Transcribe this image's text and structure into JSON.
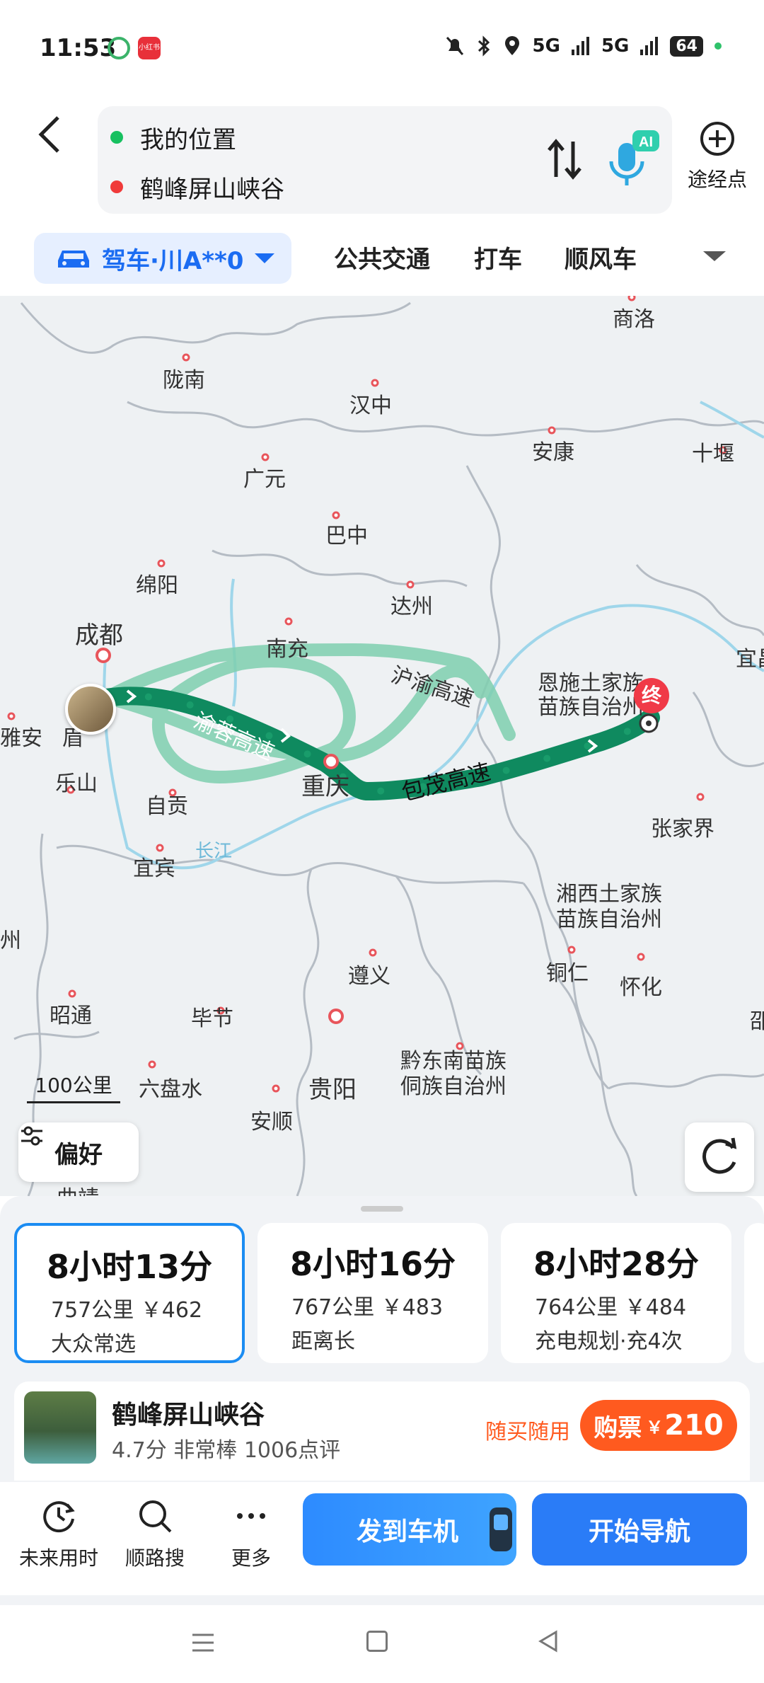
{
  "status_bar": {
    "time": "11:53",
    "app_icon_2_text": "小红书",
    "network_1": "5G",
    "network_2": "5G",
    "battery": "64"
  },
  "route": {
    "start": "我的位置",
    "destination": "鹤峰屏山峡谷",
    "waypoint_label": "途经点",
    "ai_badge": "AI"
  },
  "modes": {
    "drive": "驾车·川A**0",
    "transit": "公共交通",
    "taxi": "打车",
    "carpool": "顺风车"
  },
  "map": {
    "cities": [
      {
        "name": "商洛"
      },
      {
        "name": "陇南"
      },
      {
        "name": "汉中"
      },
      {
        "name": "安康"
      },
      {
        "name": "十堰"
      },
      {
        "name": "广元"
      },
      {
        "name": "巴中"
      },
      {
        "name": "绵阳"
      },
      {
        "name": "达州"
      },
      {
        "name": "成都"
      },
      {
        "name": "南充"
      },
      {
        "name": "恩施土家族"
      },
      {
        "name": "苗族自治州"
      },
      {
        "name": "宜昌"
      },
      {
        "name": "雅安"
      },
      {
        "name": "眉"
      },
      {
        "name": "乐山"
      },
      {
        "name": "自贡"
      },
      {
        "name": "重庆"
      },
      {
        "name": "张家界"
      },
      {
        "name": "宜宾"
      },
      {
        "name": "长江"
      },
      {
        "name": "湘西土家族"
      },
      {
        "name": "苗族自治州"
      },
      {
        "name": "州"
      },
      {
        "name": "遵义"
      },
      {
        "name": "铜仁"
      },
      {
        "name": "怀化"
      },
      {
        "name": "昭通"
      },
      {
        "name": "毕节"
      },
      {
        "name": "黔东南苗族"
      },
      {
        "name": "侗族自治州"
      },
      {
        "name": "六盘水"
      },
      {
        "name": "贵阳"
      },
      {
        "name": "安顺"
      },
      {
        "name": "曲靖"
      },
      {
        "name": "邵"
      }
    ],
    "highway_labels": [
      "沪渝高速",
      "渝蓉高速",
      "包茂高速"
    ],
    "end_marker": "终",
    "scale": "100公里",
    "preference": "偏好"
  },
  "routes": [
    {
      "time": "8小时13分",
      "distance": "757公里",
      "cost": "￥462",
      "tag": "大众常选"
    },
    {
      "time": "8小时16分",
      "distance": "767公里",
      "cost": "￥483",
      "tag": "距离长"
    },
    {
      "time": "8小时28分",
      "distance": "764公里",
      "cost": "￥484",
      "tag": "充电规划·充4次"
    }
  ],
  "poi": {
    "name": "鹤峰屏山峡谷",
    "rating": "4.7分",
    "rating_text": "非常棒",
    "reviews": "1006点评",
    "tag": "随买随用",
    "buy_label": "购票",
    "currency": "￥",
    "price": "210"
  },
  "bottom_bar": {
    "future": "未来用时",
    "along": "顺路搜",
    "more": "更多",
    "send": "发到车机",
    "start": "开始导航"
  },
  "colors": {
    "accent": "#1b6cf2",
    "route_main": "#0f8a5f",
    "route_alt": "#7fcfb0",
    "price_orange": "#ff5a1f"
  }
}
